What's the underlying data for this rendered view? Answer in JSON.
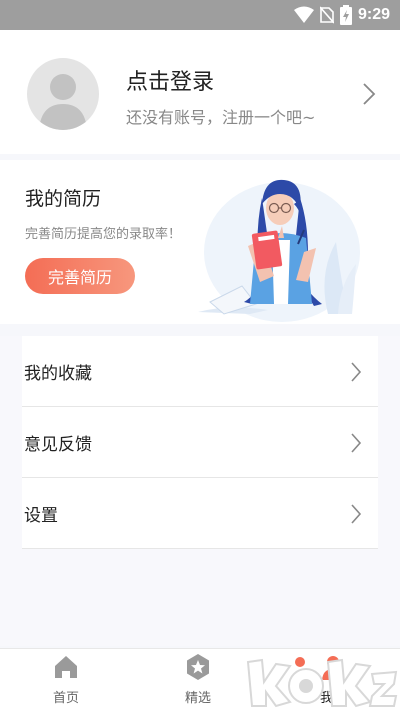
{
  "status_bar": {
    "time": "9:29"
  },
  "profile": {
    "title": "点击登录",
    "subtitle": "还没有账号，注册一个吧~"
  },
  "resume": {
    "title": "我的简历",
    "description": "完善简历提高您的录取率！",
    "button_label": "完善简历"
  },
  "menu": {
    "items": [
      {
        "label": "我的收藏"
      },
      {
        "label": "意见反馈"
      },
      {
        "label": "设置"
      }
    ]
  },
  "tabbar": {
    "tabs": [
      {
        "label": "首页",
        "icon": "home-icon"
      },
      {
        "label": "精选",
        "icon": "star-badge-icon"
      },
      {
        "label": "我的",
        "icon": "profile-icon",
        "active": true
      }
    ]
  },
  "colors": {
    "accent": "#f46d55",
    "tab_inactive_icon": "#9a9a9a",
    "tab_active_icon": "#f46d55"
  }
}
